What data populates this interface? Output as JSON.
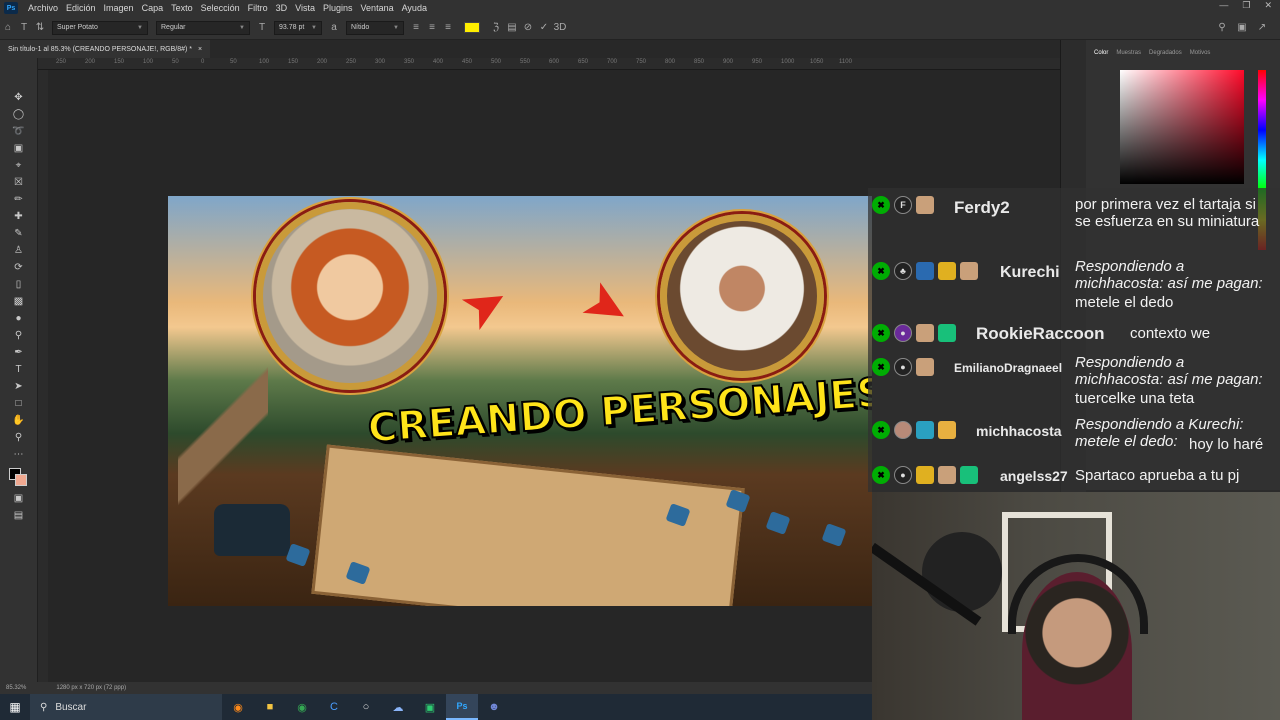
{
  "menubar": {
    "app_icon": "Ps",
    "items": [
      "Archivo",
      "Edición",
      "Imagen",
      "Capa",
      "Texto",
      "Selección",
      "Filtro",
      "3D",
      "Vista",
      "Plugins",
      "Ventana",
      "Ayuda"
    ]
  },
  "options": {
    "font_family": "Super Potato",
    "font_style": "Regular",
    "font_size": "93.78 pt",
    "antialias": "Nítido",
    "text_color": "#ffee00"
  },
  "document": {
    "tab_title": "Sin título-1 al 85.3% (CREANDO PERSONAJE!, RGB/8#) *",
    "ruler_ticks": [
      "250",
      "200",
      "150",
      "100",
      "50",
      "0",
      "50",
      "100",
      "150",
      "200",
      "250",
      "300",
      "350",
      "400",
      "450",
      "500",
      "550",
      "600",
      "650",
      "700",
      "750",
      "800",
      "850",
      "900",
      "950",
      "1000",
      "1050",
      "1100"
    ]
  },
  "canvas": {
    "headline": "CREANDO PERSONAJES!"
  },
  "panel": {
    "tabs": [
      "Color",
      "Muestras",
      "Degradados",
      "Motivos"
    ]
  },
  "chat": {
    "messages": [
      {
        "user": "Ferdy2",
        "text": "por primera vez el tartaja si se esfuerza en su miniatura",
        "reply": ""
      },
      {
        "user": "Kurechi",
        "text": "metele el dedo",
        "reply": "Respondiendo a michhacosta: así me pagan:"
      },
      {
        "user": "RookieRaccoon",
        "text": "contexto we",
        "reply": ""
      },
      {
        "user": "EmilianoDragnaeel",
        "text": "tuercelke una teta",
        "reply": "Respondiendo a michhacosta: así me pagan:"
      },
      {
        "user": "michhacosta",
        "text": "hoy lo haré",
        "reply": "Respondiendo a Kurechi: metele el dedo:"
      },
      {
        "user": "angelss27",
        "text": "Spartaco aprueba a tu pj",
        "reply": ""
      }
    ]
  },
  "statusbar": {
    "zoom": "85.32%",
    "doc_size": "1280 px x 720 px (72 ppp)"
  },
  "taskbar": {
    "search_label": "Buscar"
  }
}
